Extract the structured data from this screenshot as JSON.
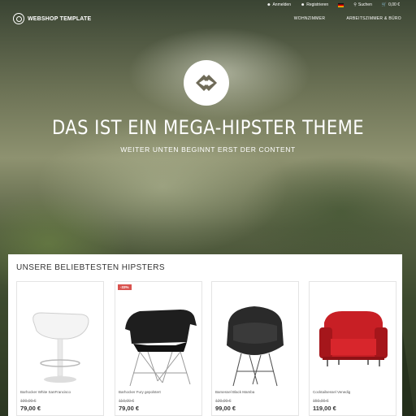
{
  "topbar": {
    "login": "Anmelden",
    "register": "Registrieren",
    "search": "Suchen",
    "cart": "0,00 €"
  },
  "brand": {
    "name": "WEBSHOP TEMPLATE"
  },
  "nav": [
    "WOHNZIMMER",
    "ARBEITSZIMMER & BÜRO"
  ],
  "hero": {
    "title": "DAS IST EIN MEGA-HIPSTER THEME",
    "subtitle": "WEITER UNTEN BEGINNT ERST DER CONTENT"
  },
  "products_section": {
    "title": "UNSERE BELIEBTESTEN HIPSTERS",
    "items": [
      {
        "name": "Barhocker White SanFrancisco",
        "old_price": "100,00 €",
        "price": "79,00 €",
        "badge": ""
      },
      {
        "name": "Barhocker Fury gepolstert",
        "old_price": "110,00 €",
        "price": "79,00 €",
        "badge": "-33%"
      },
      {
        "name": "Barsessel Black Mamba",
        "old_price": "120,00 €",
        "price": "99,00 €",
        "badge": ""
      },
      {
        "name": "Cocktailsessel Venedig",
        "old_price": "150,00 €",
        "price": "119,00 €",
        "badge": ""
      }
    ]
  },
  "colors": {
    "sale_badge": "#d9534f",
    "chair_red": "#c81f25"
  }
}
